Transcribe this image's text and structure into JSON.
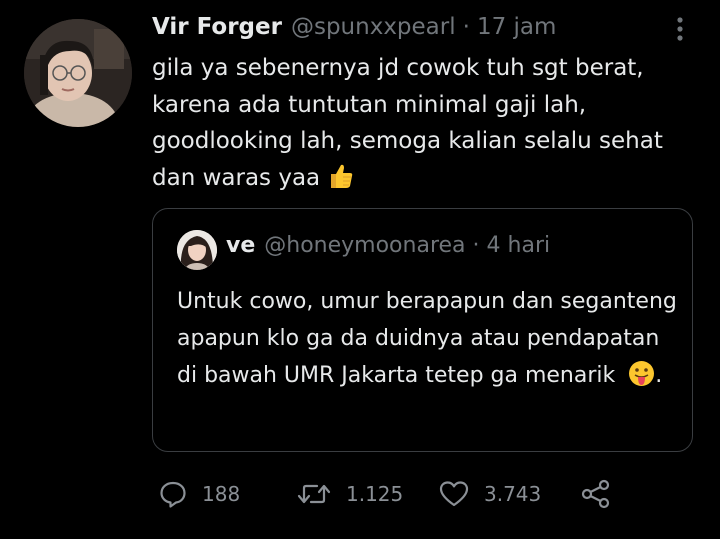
{
  "tweet": {
    "display_name": "Vir Forger",
    "handle": "@spunxxpearl",
    "separator": "·",
    "time": "17 jam",
    "text": "gila ya sebenernya jd cowok tuh sgt berat, karena ada tuntutan minimal gaji lah, goodlooking lah, semoga kalian selalu sehat dan waras yaa",
    "text_emoji": "thumbs-up-emoji"
  },
  "quoted": {
    "display_name": "ve",
    "handle": "@honeymoonarea",
    "separator": "·",
    "time": "4 hari",
    "text": "Untuk cowo, umur berapapun dan seganteng apapun klo ga da duidnya atau pendapatan di bawah UMR Jakarta tetep ga menarik",
    "text_emoji": "tongue-out-emoji",
    "text_suffix": "."
  },
  "actions": {
    "reply_count": "188",
    "retweet_count": "1.125",
    "like_count": "3.743"
  },
  "icons": {
    "more": "more-vertical-icon",
    "reply": "reply-icon",
    "retweet": "retweet-icon",
    "like": "heart-icon",
    "share": "share-icon"
  },
  "colors": {
    "background": "#000000",
    "text": "#e7e9ea",
    "secondary": "#71767b",
    "border": "#3a3d41"
  }
}
